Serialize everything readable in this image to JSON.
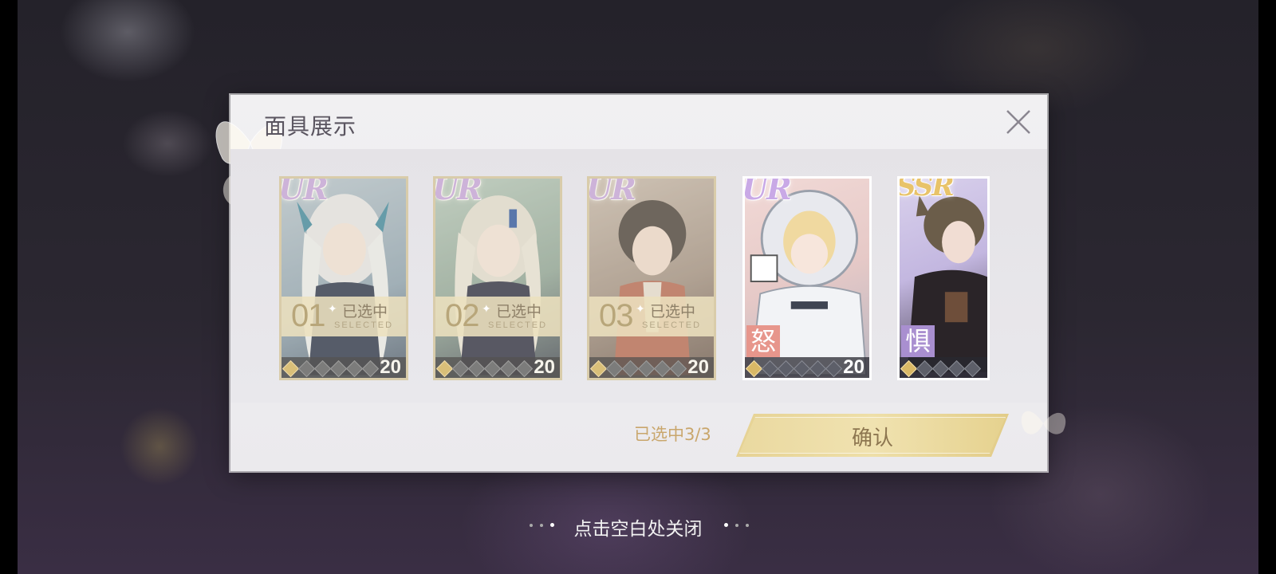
{
  "dialog": {
    "title": "面具展示",
    "close_icon": "close-icon"
  },
  "cards": [
    {
      "rarity": "UR",
      "emotion": "",
      "level": "20",
      "stars_on": 1,
      "stars_total": 6,
      "selected": true,
      "selected_index": "01",
      "selected_label": "已选中",
      "selected_sub": "SELECTED"
    },
    {
      "rarity": "UR",
      "emotion": "",
      "level": "20",
      "stars_on": 1,
      "stars_total": 6,
      "selected": true,
      "selected_index": "02",
      "selected_label": "已选中",
      "selected_sub": "SELECTED"
    },
    {
      "rarity": "UR",
      "emotion": "",
      "level": "20",
      "stars_on": 1,
      "stars_total": 6,
      "selected": true,
      "selected_index": "03",
      "selected_label": "已选中",
      "selected_sub": "SELECTED"
    },
    {
      "rarity": "UR",
      "emotion": "怒",
      "emotion_color": "#e7968c",
      "level": "20",
      "stars_on": 1,
      "stars_total": 6,
      "selected": false
    },
    {
      "rarity": "SSR",
      "emotion": "惧",
      "emotion_color": "#a98fd0",
      "level": "",
      "stars_on": 1,
      "stars_total": 5,
      "selected": false
    }
  ],
  "footer": {
    "count_text": "已选中3/3",
    "confirm_label": "确认"
  },
  "close_hint": "点击空白处关闭",
  "colors": {
    "accent_gold": "#e6d294",
    "count_text": "#c9a66c",
    "ur_rarity": "#c9a9e6",
    "ssr_rarity": "#e8c36a"
  }
}
